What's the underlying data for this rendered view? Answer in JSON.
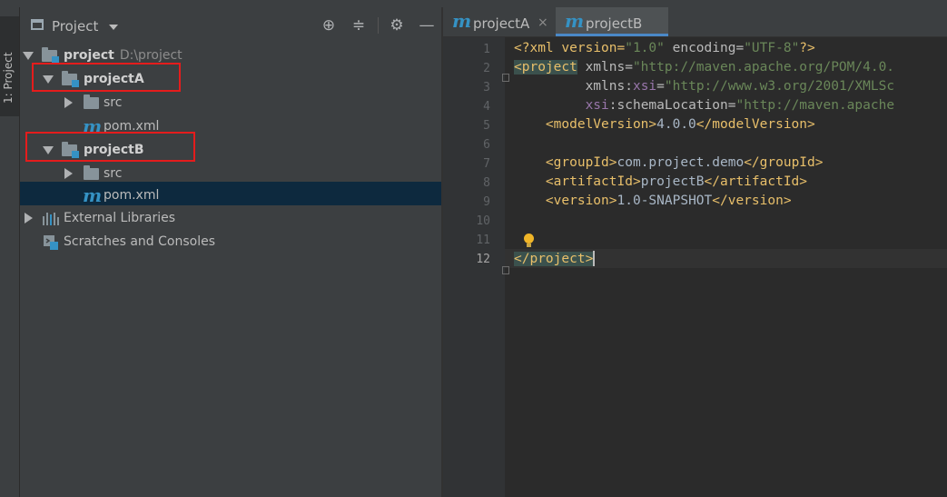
{
  "side_tab": {
    "label": "1: Project"
  },
  "project_panel": {
    "title": "Project",
    "tree": [
      {
        "label": "project",
        "path": "D:\\project"
      },
      {
        "label": "projectA"
      },
      {
        "label": "src"
      },
      {
        "label": "pom.xml"
      },
      {
        "label": "projectB"
      },
      {
        "label": "src"
      },
      {
        "label": "pom.xml"
      },
      {
        "label": "External Libraries"
      },
      {
        "label": "Scratches and Consoles"
      }
    ]
  },
  "editor": {
    "tabs": [
      {
        "label": "projectA",
        "close": "×"
      },
      {
        "label": "projectB"
      }
    ],
    "line_numbers": [
      "1",
      "2",
      "3",
      "4",
      "5",
      "6",
      "7",
      "8",
      "9",
      "10",
      "11",
      "12"
    ],
    "current_line": "12",
    "code": {
      "l1_a": "<?xml version=",
      "l1_b": "\"1.0\"",
      "l1_c": " encoding=",
      "l1_d": "\"UTF-8\"",
      "l1_e": "?>",
      "l2_a": "<project",
      "l2_b": " xmlns=",
      "l2_c": "\"http://maven.apache.org/POM/4.0.",
      "l3_indent": "         ",
      "l3_a": "xmlns:",
      "l3_b": "xsi",
      "l3_c": "=",
      "l3_d": "\"http://www.w3.org/2001/XMLSc",
      "l4_indent": "         ",
      "l4_a": "xsi",
      "l4_b": ":schemaLocation=",
      "l4_c": "\"http://maven.apache",
      "l5_indent": "    ",
      "l5_a": "<modelVersion>",
      "l5_b": "4.0.0",
      "l5_c": "</modelVersion>",
      "l7_indent": "    ",
      "l7_a": "<groupId>",
      "l7_b": "com.project.demo",
      "l7_c": "</groupId>",
      "l8_indent": "    ",
      "l8_a": "<artifactId>",
      "l8_b": "projectB",
      "l8_c": "</artifactId>",
      "l9_indent": "    ",
      "l9_a": "<version>",
      "l9_b": "1.0-SNAPSHOT",
      "l9_c": "</version>",
      "l12_a": "</project>"
    }
  },
  "colors": {
    "panel_bg": "#3c3f41",
    "editor_bg": "#2b2b2b",
    "selection": "#0d293e",
    "highlight_box": "#e51c1c",
    "tag": "#e8bf6a",
    "string": "#6a8759"
  }
}
